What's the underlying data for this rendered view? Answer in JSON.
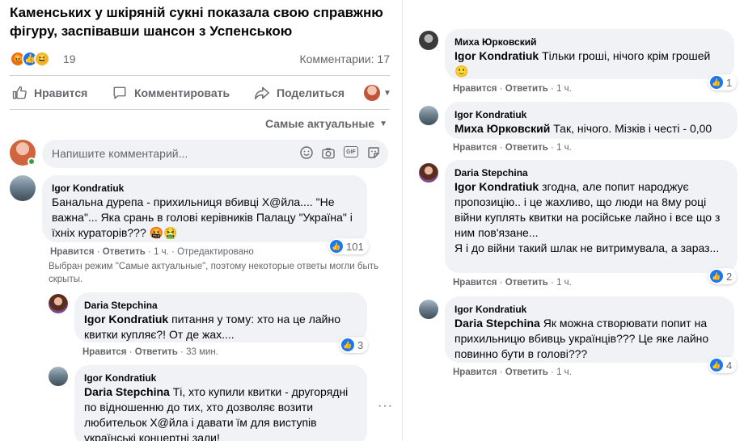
{
  "post": {
    "title": "Каменських у шкіряній сукні показала свою справжню фігуру, заспівавши шансон з Успенською",
    "reactions_count": "19",
    "comments_count": "Комментарии: 17",
    "actions": {
      "like": "Нравится",
      "comment": "Комментировать",
      "share": "Поделиться"
    },
    "sort_label": "Самые актуальные",
    "composer_placeholder": "Напишите комментарий..."
  },
  "comments_left": [
    {
      "author": "Igor Kondratiuk",
      "text": "Банальна дурепа - прихильниця вбивці Х@йла.... \"Не важна\"... Яка срань в голові керівників Палацу \"Україна\" і їхніх кураторів??? 🤬🤮",
      "likes": "101",
      "meta": {
        "like": "Нравится",
        "reply": "Ответить",
        "time": "1 ч.",
        "extra": "Отредактировано"
      }
    }
  ],
  "filter_note": "Выбран режим \"Самые актуальные\", поэтому некоторые ответы могли быть скрыты.",
  "replies_left": [
    {
      "author": "Daria Stepchina",
      "mention": "Igor Kondratiuk",
      "text": "питання у тому: хто на це лайно квитки купляє?! От де жах....",
      "likes": "3",
      "meta": {
        "like": "Нравится",
        "reply": "Ответить",
        "time": "33 мин."
      }
    },
    {
      "author": "Igor Kondratiuk",
      "mention": "Daria Stepchina",
      "text": "Ті, хто купили квитки - другорядні по відношенню до тих, хто дозволяє возити любительок Х@йла і давати їм для виступів українські концертні зали!"
    }
  ],
  "comments_right": [
    {
      "author": "Миха Юрковский",
      "mention": "Igor Kondratiuk",
      "text": "Тільки гроші, нічого крім грошей 🙂",
      "likes": "1",
      "meta": {
        "like": "Нравится",
        "reply": "Ответить",
        "time": "1 ч."
      }
    },
    {
      "author": "Igor Kondratiuk",
      "mention": "Миха Юрковский",
      "text": "Так, нічого. Мізків і честі - 0,00",
      "meta": {
        "like": "Нравится",
        "reply": "Ответить",
        "time": "1 ч."
      }
    },
    {
      "author": "Daria Stepchina",
      "mention": "Igor Kondratiuk",
      "text": "згодна, але попит народжує пропозицію.. і це жахливо, що люди на 8му році війни куплять квитки на російське лайно і все що з ним пов'язане...",
      "text2": "Я і до війни такий шлак не витримувала, а зараз...",
      "likes": "2",
      "meta": {
        "like": "Нравится",
        "reply": "Ответить",
        "time": "1 ч."
      }
    },
    {
      "author": "Igor Kondratiuk",
      "mention": "Daria Stepchina",
      "text": "Як можна створювати попит на прихильницю вбивць українців??? Це яке лайно повинно бути в голові???",
      "likes": "4",
      "meta": {
        "like": "Нравится",
        "reply": "Ответить",
        "time": "1 ч."
      }
    }
  ],
  "colors": {
    "brand_blue": "#1877f2",
    "meta_gray": "#65676b",
    "bubble_bg": "#f0f2f5",
    "online_green": "#31a24c"
  },
  "icons": [
    "thumbs-up-icon",
    "comment-icon",
    "share-icon",
    "emoji-icon",
    "camera-icon",
    "gif-icon",
    "sticker-icon",
    "sort-caret-icon",
    "more-dots-icon"
  ]
}
